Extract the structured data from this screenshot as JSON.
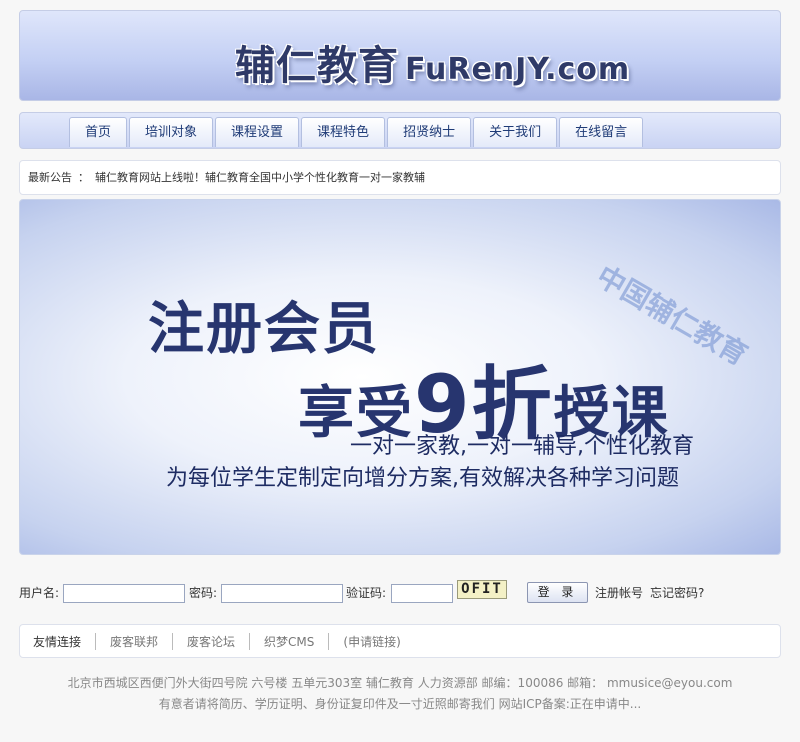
{
  "header": {
    "logo_cn": "辅仁教育",
    "logo_en": "FuRenJY.com"
  },
  "nav": {
    "items": [
      "首页",
      "培训对象",
      "课程设置",
      "课程特色",
      "招贤纳士",
      "关于我们",
      "在线留言"
    ]
  },
  "notice": {
    "label": "最新公告",
    "separator": "：",
    "text": "辅仁教育网站上线啦！辅仁教育全国中小学个性化教育一对一家教辅"
  },
  "banner": {
    "watermark": "中国辅仁教育",
    "line1": "注册会员",
    "line2_prefix": "享受",
    "line2_big": "9折",
    "line2_suffix": "授课",
    "sub1": "一对一家教,一对一辅导,个性化教育",
    "sub2": "为每位学生定制定向增分方案,有效解决各种学习问题"
  },
  "login": {
    "username_label": "用户名:",
    "password_label": "密码:",
    "captcha_label": "验证码:",
    "captcha_text": "OFIT",
    "login_button": "登 录",
    "register_link": "注册帐号",
    "forgot_link": "忘记密码?"
  },
  "friends": {
    "title": "友情连接",
    "links": [
      "废客联邦",
      "废客论坛",
      "织梦CMS",
      "(申请链接)"
    ]
  },
  "footer": {
    "line1": "北京市西城区西便门外大街四号院  六号楼  五单元303室  辅仁教育  人力资源部  邮编：100086 邮箱：  mmusice@eyou.com",
    "line2": "有意者请将简历、学历证明、身份证复印件及一寸近照邮寄我们    网站ICP备案:正在申请中..."
  },
  "colors": {
    "nav_text": "#1f3b77",
    "banner_text": "#27356f",
    "header_gradient_bottom": "#a9b6e6"
  }
}
